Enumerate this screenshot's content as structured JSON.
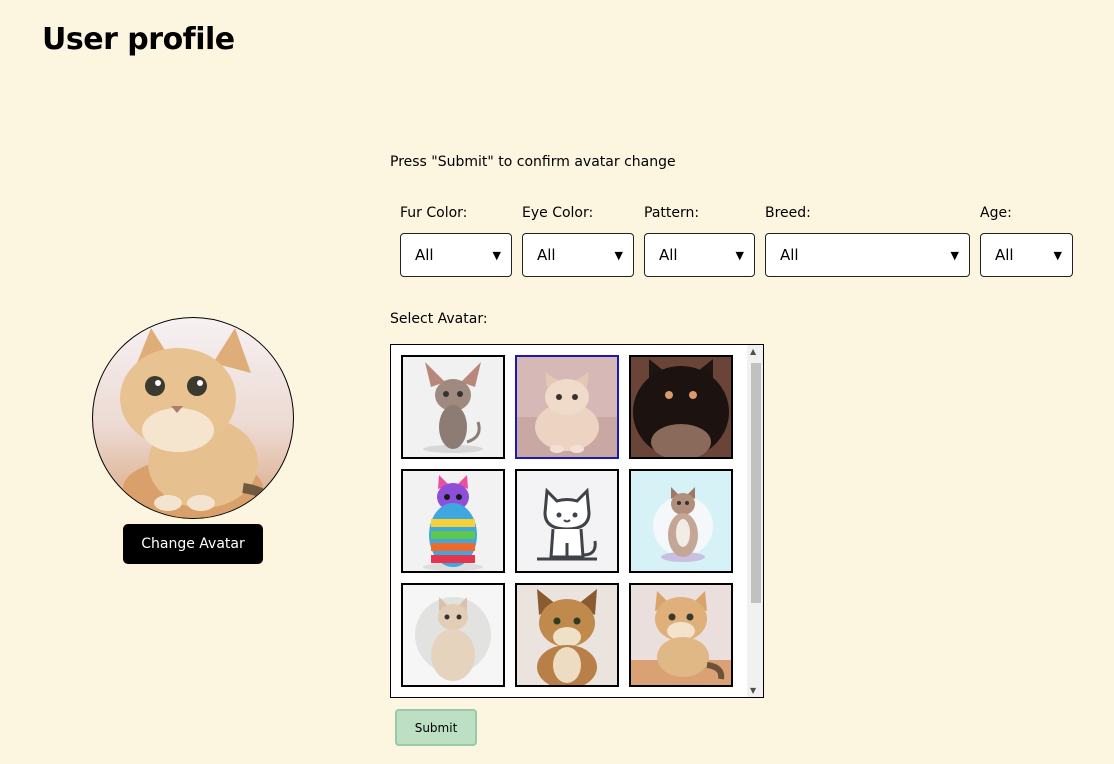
{
  "page": {
    "title": "User profile"
  },
  "profile": {
    "change_avatar_label": "Change Avatar"
  },
  "instruction": "Press \"Submit\" to confirm avatar change",
  "filters": [
    {
      "label": "Fur Color:",
      "value": "All"
    },
    {
      "label": "Eye Color:",
      "value": "All"
    },
    {
      "label": "Pattern:",
      "value": "All"
    },
    {
      "label": "Breed:",
      "value": "All"
    },
    {
      "label": "Age:",
      "value": "All"
    }
  ],
  "select_avatar_label": "Select Avatar:",
  "avatars": [
    {
      "name": "sphynx-cat",
      "selected": false
    },
    {
      "name": "british-cream-cat",
      "selected": true
    },
    {
      "name": "black-longhair-cat",
      "selected": false
    },
    {
      "name": "rainbow-cat",
      "selected": false
    },
    {
      "name": "cartoon-line-cat",
      "selected": false
    },
    {
      "name": "tabby-cat-on-blue",
      "selected": false
    },
    {
      "name": "cream-cat-circle",
      "selected": false
    },
    {
      "name": "wild-cat",
      "selected": false
    },
    {
      "name": "desert-kitten",
      "selected": false
    }
  ],
  "submit_label": "Submit",
  "colors": {
    "background": "#fcf5e0",
    "submit": "#bde0c4",
    "selected_border": "#1a1ab0"
  }
}
